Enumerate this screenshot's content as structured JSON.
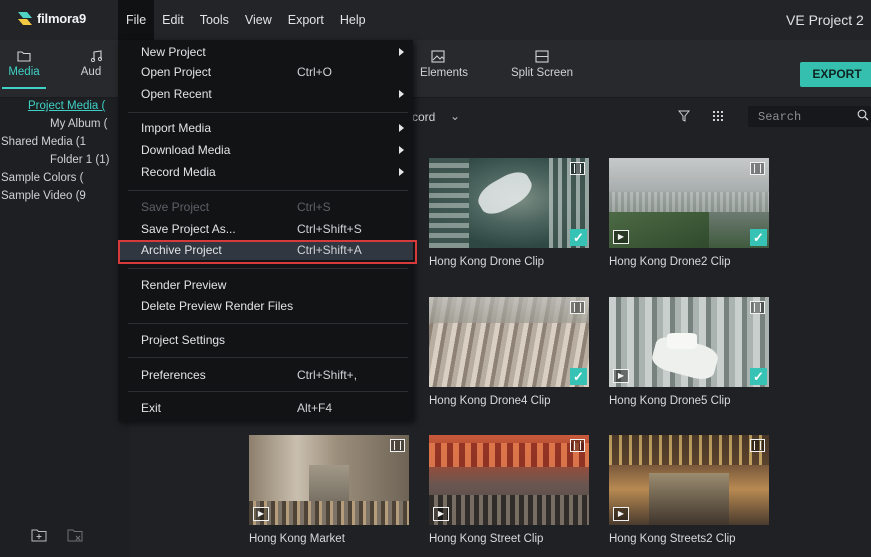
{
  "app": {
    "logo_text": "filmora9",
    "project_title": "VE Project 2"
  },
  "menubar": [
    {
      "label": "File",
      "active": true
    },
    {
      "label": "Edit"
    },
    {
      "label": "Tools"
    },
    {
      "label": "View"
    },
    {
      "label": "Export"
    },
    {
      "label": "Help"
    }
  ],
  "toolbar": {
    "tabs": [
      {
        "label": "Media",
        "icon": "folder-icon",
        "active": true
      },
      {
        "label": "Aud",
        "icon": "music-note-icon"
      },
      {
        "label": "Elements",
        "icon": "image-icon"
      },
      {
        "label": "Split Screen",
        "icon": "split-screen-icon"
      }
    ],
    "export_label": "EXPORT"
  },
  "library": {
    "items": [
      {
        "label": "Project Media (",
        "selected": true
      },
      {
        "label": "My Album ("
      },
      {
        "label": "Shared Media (1"
      },
      {
        "label": "Folder 1 (1)"
      },
      {
        "label": "Sample Colors ("
      },
      {
        "label": "Sample Video (9"
      }
    ],
    "bottom_icons": [
      "new-folder-icon",
      "delete-folder-icon"
    ]
  },
  "filter": {
    "label": "cord",
    "search_placeholder": "Search",
    "accent": "#3fd1c6"
  },
  "media": [
    {
      "label": "Hong Kong Drone Clip",
      "checked": true,
      "badge": "film"
    },
    {
      "label": "Hong Kong Drone2 Clip",
      "checked": true,
      "badge": "film"
    },
    {
      "label": "Hong Kong Drone4 Clip",
      "checked": true,
      "badge": "film"
    },
    {
      "label": "Hong Kong Drone5 Clip",
      "checked": true,
      "badge": "film"
    },
    {
      "label": "Hong Kong Market",
      "checked": false,
      "badge": "film"
    },
    {
      "label": "Hong Kong Street Clip",
      "checked": false,
      "badge": "film"
    },
    {
      "label": "Hong Kong Streets2 Clip",
      "checked": false,
      "badge": "film"
    }
  ],
  "file_menu": {
    "items": [
      {
        "label": "New Project",
        "shortcut": "",
        "submenu": true
      },
      {
        "label": "Open Project",
        "shortcut": "Ctrl+O"
      },
      {
        "label": "Open Recent",
        "shortcut": "",
        "submenu": true
      },
      {
        "label": "Import Media",
        "shortcut": "",
        "submenu": true
      },
      {
        "label": "Download Media",
        "shortcut": "",
        "submenu": true
      },
      {
        "label": "Record Media",
        "shortcut": "",
        "submenu": true
      },
      {
        "label": "Save Project",
        "shortcut": "Ctrl+S",
        "disabled": true
      },
      {
        "label": "Save Project As...",
        "shortcut": "Ctrl+Shift+S"
      },
      {
        "label": "Archive Project",
        "shortcut": "Ctrl+Shift+A",
        "highlighted": true
      },
      {
        "label": "Render Preview",
        "shortcut": ""
      },
      {
        "label": "Delete Preview Render Files",
        "shortcut": ""
      },
      {
        "label": "Project Settings",
        "shortcut": ""
      },
      {
        "label": "Preferences",
        "shortcut": "Ctrl+Shift+,"
      },
      {
        "label": "Exit",
        "shortcut": "Alt+F4"
      }
    ]
  }
}
